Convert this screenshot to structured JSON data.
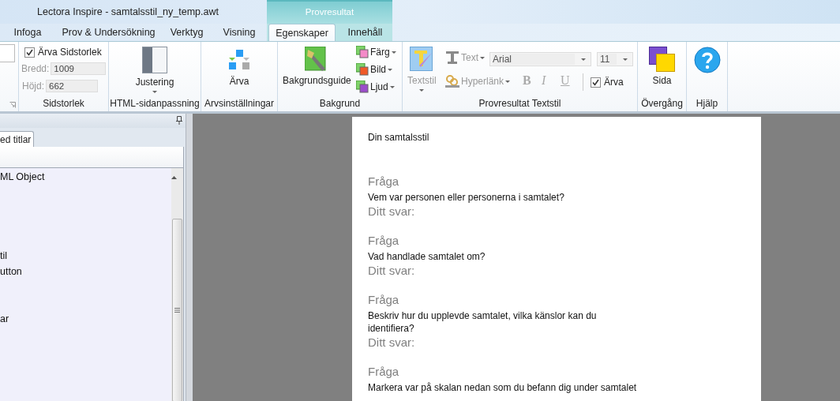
{
  "window": {
    "title": "Lectora Inspire - samtalsstil_ny_temp.awt",
    "context_tab": "Provresultat"
  },
  "tabs": [
    {
      "label": "Infoga",
      "selected": false
    },
    {
      "label": "Prov & Undersökning",
      "selected": false
    },
    {
      "label": "Verktyg",
      "selected": false
    },
    {
      "label": "Visning",
      "selected": false
    },
    {
      "label": "Egenskaper",
      "selected": true
    },
    {
      "label": "Innehåll",
      "selected": false
    }
  ],
  "ribbon": {
    "page_size": {
      "label": "Sidstorlek",
      "inherit": {
        "label": "Ärva Sidstorlek",
        "checked": true
      },
      "fields": [
        {
          "label": "Bredd:",
          "value": "1009",
          "disabled": true
        },
        {
          "label": "Höjd:",
          "value": "662",
          "disabled": true
        }
      ]
    },
    "html_fit": {
      "label": "HTML-sidanpassning",
      "button": "Justering"
    },
    "inheritance": {
      "label": "Arvsinställningar",
      "button": "Ärva"
    },
    "background": {
      "label": "Bakgrund",
      "button": "Bakgrundsguide",
      "menus": [
        {
          "kind": "color",
          "label": "Färg"
        },
        {
          "kind": "image",
          "label": "Bild"
        },
        {
          "kind": "sound",
          "label": "Ljud"
        }
      ]
    },
    "text_style": {
      "label": "Provresultat Textstil",
      "style_button": {
        "label": "Textstil",
        "disabled": true
      },
      "text_button": {
        "label": "Text",
        "disabled": true
      },
      "font": "Arial",
      "size": "11",
      "link_button": {
        "label": "Hyperlänk",
        "disabled": true
      },
      "format_buttons": [
        {
          "label": "B",
          "disabled": true
        },
        {
          "label": "I",
          "disabled": true
        },
        {
          "label": "U",
          "disabled": true
        }
      ],
      "inherit": {
        "label": "Ärva",
        "checked": true
      }
    },
    "transition": {
      "label": "Övergång",
      "button": "Sida"
    },
    "help": {
      "label": "Hjälp"
    }
  },
  "left_pane": {
    "tab": "ed titlar",
    "items": [
      "ML Object",
      "til",
      "utton",
      "ar"
    ]
  },
  "document": {
    "title": "Din samtalsstil",
    "questions": [
      {
        "label": "Fråga",
        "text": "Vem var personen eller personerna i samtalet?",
        "answer_label": "Ditt svar:"
      },
      {
        "label": "Fråga",
        "text": "Vad handlade samtalet om?",
        "answer_label": "Ditt svar:"
      },
      {
        "label": "Fråga",
        "text": "Beskriv hur du upplevde samtalet, vilka känslor kan du identifiera?",
        "answer_label": "Ditt svar:"
      },
      {
        "label": "Fråga",
        "text": "Markera var på skalan nedan som du befann dig under samtalet"
      }
    ]
  }
}
